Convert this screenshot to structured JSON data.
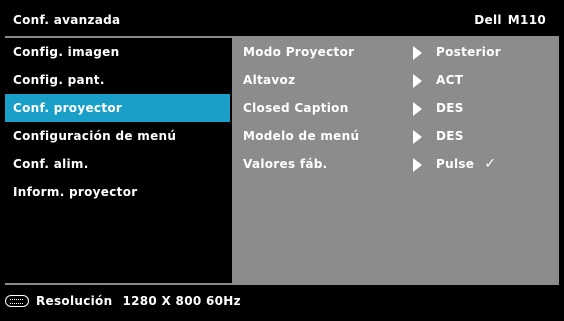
{
  "header": {
    "title": "Conf. avanzada",
    "brand": "Dell",
    "model": "M110"
  },
  "menu": {
    "items": [
      {
        "label": "Config. imagen"
      },
      {
        "label": "Config. pant."
      },
      {
        "label": "Conf. proyector",
        "selected": true
      },
      {
        "label": "Configuración de menú"
      },
      {
        "label": "Conf. alim."
      },
      {
        "label": "Inform. proyector"
      }
    ]
  },
  "settings": [
    {
      "label": "Modo Proyector",
      "value": "Posterior"
    },
    {
      "label": "Altavoz",
      "value": "ACT"
    },
    {
      "label": "Closed Caption",
      "value": "DES"
    },
    {
      "label": "Modelo de menú",
      "value": "DES"
    },
    {
      "label": "Valores fáb.",
      "value": "Pulse",
      "check": "✓"
    }
  ],
  "footer": {
    "icon": "remote-keypad-icon",
    "label": "Resolución",
    "resolution": "1280 X 800 60Hz"
  },
  "colors": {
    "background": "#000000",
    "selected": "#1aa0c8",
    "panel": "#8c8c8c",
    "text": "#ffffff"
  }
}
